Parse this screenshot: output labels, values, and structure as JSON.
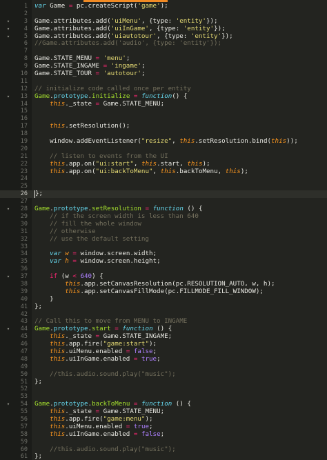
{
  "editor": {
    "active_line": 26,
    "colors": {
      "background": "#232420",
      "gutter": "#1b1c19",
      "tab_accent": "#f08a24",
      "keyword": "#66d9ef",
      "string": "#e6db74",
      "number": "#ae81ff",
      "operator": "#f92672",
      "comment": "#75715e",
      "this": "#fd971f",
      "class": "#a6e22e"
    },
    "fold_icon": "fold-triangle-icon",
    "lines": [
      {
        "n": "1",
        "fold": false,
        "tokens": [
          [
            "kw",
            "var"
          ],
          [
            "c",
            " Game "
          ],
          [
            "op",
            "="
          ],
          [
            "c",
            " pc.createScript("
          ],
          [
            "str",
            "'game'"
          ],
          [
            "c",
            ");"
          ]
        ]
      },
      {
        "n": "2",
        "fold": false,
        "tokens": []
      },
      {
        "n": "3",
        "fold": true,
        "tokens": [
          [
            "c",
            "Game.attributes.add("
          ],
          [
            "str",
            "'uiMenu'"
          ],
          [
            "c",
            ", {type: "
          ],
          [
            "str",
            "'entity'"
          ],
          [
            "c",
            "});"
          ]
        ]
      },
      {
        "n": "4",
        "fold": true,
        "tokens": [
          [
            "c",
            "Game.attributes.add("
          ],
          [
            "str",
            "'uiInGame'"
          ],
          [
            "c",
            ", {type: "
          ],
          [
            "str",
            "'entity'"
          ],
          [
            "c",
            "});"
          ]
        ]
      },
      {
        "n": "5",
        "fold": true,
        "tokens": [
          [
            "c",
            "Game.attributes.add("
          ],
          [
            "str",
            "'uiautotour'"
          ],
          [
            "c",
            ", {type: "
          ],
          [
            "str",
            "'entity'"
          ],
          [
            "c",
            "});"
          ]
        ]
      },
      {
        "n": "6",
        "fold": false,
        "tokens": [
          [
            "com",
            "//Game.attributes.add('audio', {type: 'entity'});"
          ]
        ]
      },
      {
        "n": "7",
        "fold": false,
        "tokens": []
      },
      {
        "n": "8",
        "fold": false,
        "tokens": [
          [
            "c",
            "Game.STATE_MENU "
          ],
          [
            "op",
            "="
          ],
          [
            "c",
            " "
          ],
          [
            "str",
            "'menu'"
          ],
          [
            "c",
            ";"
          ]
        ]
      },
      {
        "n": "9",
        "fold": false,
        "tokens": [
          [
            "c",
            "Game.STATE_INGAME "
          ],
          [
            "op",
            "="
          ],
          [
            "c",
            " "
          ],
          [
            "str",
            "'ingame'"
          ],
          [
            "c",
            ";"
          ]
        ]
      },
      {
        "n": "10",
        "fold": false,
        "tokens": [
          [
            "c",
            "Game.STATE_TOUR "
          ],
          [
            "op",
            "="
          ],
          [
            "c",
            " "
          ],
          [
            "str",
            "'autotour'"
          ],
          [
            "c",
            ";"
          ]
        ]
      },
      {
        "n": "11",
        "fold": false,
        "tokens": []
      },
      {
        "n": "12",
        "fold": false,
        "tokens": [
          [
            "com",
            "// initialize code called once per entity"
          ]
        ]
      },
      {
        "n": "13",
        "fold": true,
        "tokens": [
          [
            "cls",
            "Game"
          ],
          [
            "c",
            "."
          ],
          [
            "proto",
            "prototype"
          ],
          [
            "c",
            "."
          ],
          [
            "cls",
            "initialize"
          ],
          [
            "c",
            " "
          ],
          [
            "op",
            "="
          ],
          [
            "c",
            " "
          ],
          [
            "fn",
            "function"
          ],
          [
            "c",
            "() {"
          ]
        ]
      },
      {
        "n": "14",
        "fold": false,
        "tokens": [
          [
            "c",
            "    "
          ],
          [
            "this",
            "this"
          ],
          [
            "c",
            "._state "
          ],
          [
            "op",
            "="
          ],
          [
            "c",
            " Game.STATE_MENU;"
          ]
        ]
      },
      {
        "n": "15",
        "fold": false,
        "tokens": []
      },
      {
        "n": "16",
        "fold": false,
        "tokens": []
      },
      {
        "n": "17",
        "fold": false,
        "tokens": [
          [
            "c",
            "    "
          ],
          [
            "this",
            "this"
          ],
          [
            "c",
            ".setResolution();"
          ]
        ]
      },
      {
        "n": "18",
        "fold": false,
        "tokens": []
      },
      {
        "n": "19",
        "fold": false,
        "tokens": [
          [
            "c",
            "    window.addEventListener("
          ],
          [
            "str",
            "\"resize\""
          ],
          [
            "c",
            ", "
          ],
          [
            "this",
            "this"
          ],
          [
            "c",
            ".setResolution.bind("
          ],
          [
            "this",
            "this"
          ],
          [
            "c",
            "));"
          ]
        ]
      },
      {
        "n": "20",
        "fold": false,
        "tokens": []
      },
      {
        "n": "21",
        "fold": false,
        "tokens": [
          [
            "c",
            "    "
          ],
          [
            "com",
            "// listen to events from the UI"
          ]
        ]
      },
      {
        "n": "22",
        "fold": false,
        "tokens": [
          [
            "c",
            "    "
          ],
          [
            "this",
            "this"
          ],
          [
            "c",
            ".app.on("
          ],
          [
            "str",
            "\"ui:start\""
          ],
          [
            "c",
            ", "
          ],
          [
            "this",
            "this"
          ],
          [
            "c",
            ".start, "
          ],
          [
            "this",
            "this"
          ],
          [
            "c",
            ");"
          ]
        ]
      },
      {
        "n": "23",
        "fold": false,
        "tokens": [
          [
            "c",
            "    "
          ],
          [
            "this",
            "this"
          ],
          [
            "c",
            ".app.on("
          ],
          [
            "str",
            "\"ui:backToMenu\""
          ],
          [
            "c",
            ", "
          ],
          [
            "this",
            "this"
          ],
          [
            "c",
            ".backToMenu, "
          ],
          [
            "this",
            "this"
          ],
          [
            "c",
            ");"
          ]
        ]
      },
      {
        "n": "24",
        "fold": false,
        "tokens": []
      },
      {
        "n": "25",
        "fold": false,
        "tokens": []
      },
      {
        "n": "26",
        "fold": false,
        "tokens": [
          [
            "c",
            "};"
          ]
        ]
      },
      {
        "n": "27",
        "fold": false,
        "tokens": []
      },
      {
        "n": "28",
        "fold": true,
        "tokens": [
          [
            "cls",
            "Game"
          ],
          [
            "c",
            "."
          ],
          [
            "proto",
            "prototype"
          ],
          [
            "c",
            "."
          ],
          [
            "cls",
            "setResolution"
          ],
          [
            "c",
            " "
          ],
          [
            "op",
            "="
          ],
          [
            "c",
            " "
          ],
          [
            "fn",
            "function"
          ],
          [
            "c",
            " () {"
          ]
        ]
      },
      {
        "n": "29",
        "fold": false,
        "tokens": [
          [
            "c",
            "    "
          ],
          [
            "com",
            "// if the screen width is less than 640"
          ]
        ]
      },
      {
        "n": "30",
        "fold": false,
        "tokens": [
          [
            "c",
            "    "
          ],
          [
            "com",
            "// fill the whole window"
          ]
        ]
      },
      {
        "n": "31",
        "fold": false,
        "tokens": [
          [
            "c",
            "    "
          ],
          [
            "com",
            "// otherwise"
          ]
        ]
      },
      {
        "n": "32",
        "fold": false,
        "tokens": [
          [
            "c",
            "    "
          ],
          [
            "com",
            "// use the default setting"
          ]
        ]
      },
      {
        "n": "33",
        "fold": false,
        "tokens": []
      },
      {
        "n": "34",
        "fold": false,
        "tokens": [
          [
            "c",
            "    "
          ],
          [
            "kw",
            "var"
          ],
          [
            "c",
            " "
          ],
          [
            "this",
            "w"
          ],
          [
            "c",
            " "
          ],
          [
            "op",
            "="
          ],
          [
            "c",
            " window.screen.width;"
          ]
        ]
      },
      {
        "n": "35",
        "fold": false,
        "tokens": [
          [
            "c",
            "    "
          ],
          [
            "kw",
            "var"
          ],
          [
            "c",
            " "
          ],
          [
            "this",
            "h"
          ],
          [
            "c",
            " "
          ],
          [
            "op",
            "="
          ],
          [
            "c",
            " window.screen.height;"
          ]
        ]
      },
      {
        "n": "36",
        "fold": false,
        "tokens": []
      },
      {
        "n": "37",
        "fold": true,
        "tokens": [
          [
            "c",
            "    "
          ],
          [
            "kw2",
            "if"
          ],
          [
            "c",
            " (w "
          ],
          [
            "op",
            "<"
          ],
          [
            "c",
            " "
          ],
          [
            "num",
            "640"
          ],
          [
            "c",
            ") {"
          ]
        ]
      },
      {
        "n": "38",
        "fold": false,
        "tokens": [
          [
            "c",
            "        "
          ],
          [
            "this",
            "this"
          ],
          [
            "c",
            ".app.setCanvasResolution(pc.RESOLUTION_AUTO, w, h);"
          ]
        ]
      },
      {
        "n": "39",
        "fold": false,
        "tokens": [
          [
            "c",
            "        "
          ],
          [
            "this",
            "this"
          ],
          [
            "c",
            ".app.setCanvasFillMode(pc.FILLMODE_FILL_WINDOW);"
          ]
        ]
      },
      {
        "n": "40",
        "fold": false,
        "tokens": [
          [
            "c",
            "    }"
          ]
        ]
      },
      {
        "n": "41",
        "fold": false,
        "tokens": [
          [
            "c",
            "};"
          ]
        ]
      },
      {
        "n": "42",
        "fold": false,
        "tokens": []
      },
      {
        "n": "43",
        "fold": false,
        "tokens": [
          [
            "com",
            "// Call this to move from MENU to INGAME"
          ]
        ]
      },
      {
        "n": "44",
        "fold": true,
        "tokens": [
          [
            "cls",
            "Game"
          ],
          [
            "c",
            "."
          ],
          [
            "proto",
            "prototype"
          ],
          [
            "c",
            "."
          ],
          [
            "cls",
            "start"
          ],
          [
            "c",
            " "
          ],
          [
            "op",
            "="
          ],
          [
            "c",
            " "
          ],
          [
            "fn",
            "function"
          ],
          [
            "c",
            " () {"
          ]
        ]
      },
      {
        "n": "45",
        "fold": false,
        "tokens": [
          [
            "c",
            "    "
          ],
          [
            "this",
            "this"
          ],
          [
            "c",
            "._state "
          ],
          [
            "op",
            "="
          ],
          [
            "c",
            " Game.STATE_INGAME;"
          ]
        ]
      },
      {
        "n": "46",
        "fold": false,
        "tokens": [
          [
            "c",
            "    "
          ],
          [
            "this",
            "this"
          ],
          [
            "c",
            ".app.fire("
          ],
          [
            "str",
            "\"game:start\""
          ],
          [
            "c",
            ");"
          ]
        ]
      },
      {
        "n": "47",
        "fold": false,
        "tokens": [
          [
            "c",
            "    "
          ],
          [
            "this",
            "this"
          ],
          [
            "c",
            ".uiMenu.enabled "
          ],
          [
            "op",
            "="
          ],
          [
            "c",
            " "
          ],
          [
            "num",
            "false"
          ],
          [
            "c",
            ";"
          ]
        ]
      },
      {
        "n": "48",
        "fold": false,
        "tokens": [
          [
            "c",
            "    "
          ],
          [
            "this",
            "this"
          ],
          [
            "c",
            ".uiInGame.enabled "
          ],
          [
            "op",
            "="
          ],
          [
            "c",
            " "
          ],
          [
            "num",
            "true"
          ],
          [
            "c",
            ";"
          ]
        ]
      },
      {
        "n": "49",
        "fold": false,
        "tokens": []
      },
      {
        "n": "50",
        "fold": false,
        "tokens": [
          [
            "c",
            "    "
          ],
          [
            "com",
            "//this.audio.sound.play(\"music\");"
          ]
        ]
      },
      {
        "n": "51",
        "fold": false,
        "tokens": [
          [
            "c",
            "};"
          ]
        ]
      },
      {
        "n": "52",
        "fold": false,
        "tokens": []
      },
      {
        "n": "53",
        "fold": false,
        "tokens": []
      },
      {
        "n": "54",
        "fold": true,
        "tokens": [
          [
            "cls",
            "Game"
          ],
          [
            "c",
            "."
          ],
          [
            "proto",
            "prototype"
          ],
          [
            "c",
            "."
          ],
          [
            "cls",
            "backToMenu"
          ],
          [
            "c",
            " "
          ],
          [
            "op",
            "="
          ],
          [
            "c",
            " "
          ],
          [
            "fn",
            "function"
          ],
          [
            "c",
            " () {"
          ]
        ]
      },
      {
        "n": "55",
        "fold": false,
        "tokens": [
          [
            "c",
            "    "
          ],
          [
            "this",
            "this"
          ],
          [
            "c",
            "._state "
          ],
          [
            "op",
            "="
          ],
          [
            "c",
            " Game.STATE_MENU;"
          ]
        ]
      },
      {
        "n": "56",
        "fold": false,
        "tokens": [
          [
            "c",
            "    "
          ],
          [
            "this",
            "this"
          ],
          [
            "c",
            ".app.fire("
          ],
          [
            "str",
            "\"game:menu\""
          ],
          [
            "c",
            ");"
          ]
        ]
      },
      {
        "n": "57",
        "fold": false,
        "tokens": [
          [
            "c",
            "    "
          ],
          [
            "this",
            "this"
          ],
          [
            "c",
            ".uiMenu.enabled "
          ],
          [
            "op",
            "="
          ],
          [
            "c",
            " "
          ],
          [
            "num",
            "true"
          ],
          [
            "c",
            ";"
          ]
        ]
      },
      {
        "n": "58",
        "fold": false,
        "tokens": [
          [
            "c",
            "    "
          ],
          [
            "this",
            "this"
          ],
          [
            "c",
            ".uiInGame.enabled "
          ],
          [
            "op",
            "="
          ],
          [
            "c",
            " "
          ],
          [
            "num",
            "false"
          ],
          [
            "c",
            ";"
          ]
        ]
      },
      {
        "n": "59",
        "fold": false,
        "tokens": []
      },
      {
        "n": "60",
        "fold": false,
        "tokens": [
          [
            "c",
            "    "
          ],
          [
            "com",
            "//this.audio.sound.play(\"music\");"
          ]
        ]
      },
      {
        "n": "61",
        "fold": false,
        "tokens": [
          [
            "c",
            "};"
          ]
        ]
      }
    ]
  }
}
